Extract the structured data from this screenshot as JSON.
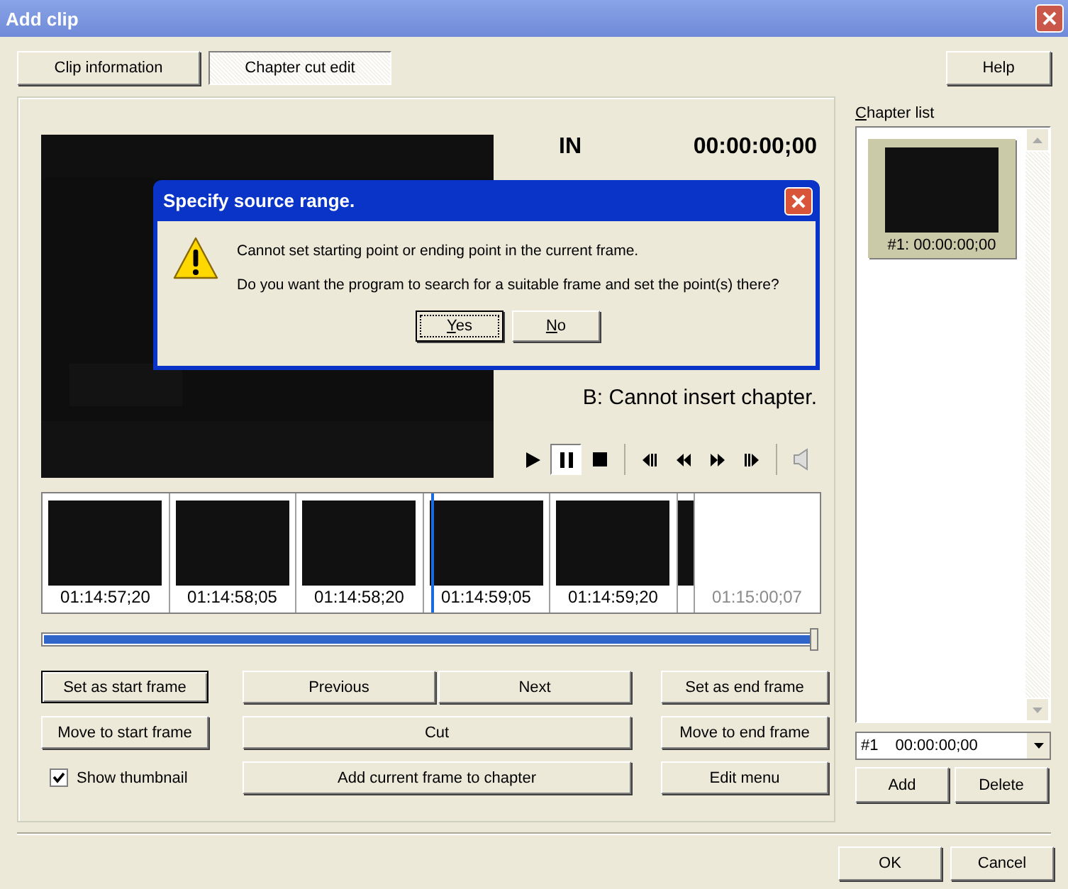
{
  "window": {
    "title": "Add clip"
  },
  "tabs": [
    {
      "label": "Clip information",
      "selected": false
    },
    {
      "label": "Chapter cut edit",
      "selected": true
    }
  ],
  "help_button": "Help",
  "timecodes": [
    {
      "label": "IN",
      "value": "00:00:00;00"
    }
  ],
  "status_message": "B: Cannot insert chapter.",
  "transport": {
    "pause_pressed": true
  },
  "thumbnails": [
    {
      "kind": "frame",
      "time": "01:14:57;20"
    },
    {
      "kind": "frame",
      "time": "01:14:58;05"
    },
    {
      "kind": "frame",
      "time": "01:14:58;20"
    },
    {
      "kind": "frame",
      "time": "01:14:59;05"
    },
    {
      "kind": "frame",
      "time": "01:14:59;20"
    },
    {
      "kind": "sliver"
    },
    {
      "kind": "blank",
      "time": "01:15:00;07"
    }
  ],
  "position_slider": {
    "level": 1
  },
  "buttons": [
    {
      "label": "Set as start frame",
      "default": true
    },
    {
      "label": "Previous",
      "default": false
    },
    {
      "label": "Next",
      "default": false
    },
    {
      "label": "Set as end frame",
      "default": false
    },
    {
      "label": "Move to start frame",
      "default": false
    },
    {
      "label": "Cut",
      "default": false
    },
    {
      "label": "Move to end frame",
      "default": false
    },
    {
      "label": "Add current frame to chapter",
      "default": false
    },
    {
      "label": "Edit menu",
      "default": false
    }
  ],
  "show_thumbnail": {
    "label": "Show thumbnail",
    "checked": true
  },
  "chapter_list": {
    "label": "Chapter list",
    "items": [
      {
        "caption": "#1: 00:00:00;00",
        "selected": true
      }
    ],
    "combo": {
      "number": "#1",
      "time": "00:00:00;00"
    },
    "add": "Add",
    "delete": "Delete"
  },
  "footer": [
    "OK",
    "Cancel"
  ],
  "dialog": {
    "title": "Specify source range.",
    "lines": [
      "Cannot set starting point or ending point in the current frame.",
      "Do you want the program to search for a suitable frame and set the point(s) there?"
    ],
    "buttons": [
      {
        "label": "Yes",
        "focused": true
      },
      {
        "label": "No",
        "focused": false
      }
    ]
  }
}
